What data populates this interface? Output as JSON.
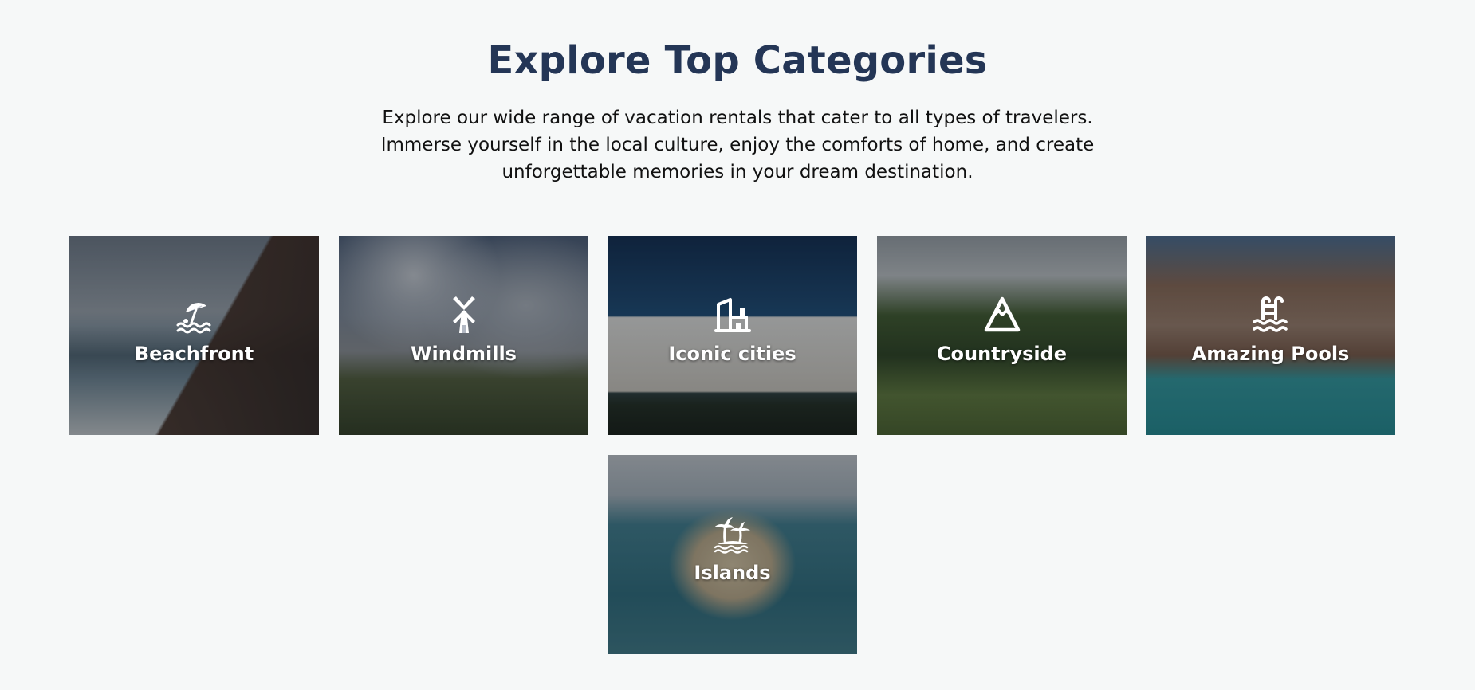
{
  "section": {
    "title": "Explore Top Categories",
    "intro_lines": [
      "Explore our wide range of vacation rentals that cater to all types of travelers.",
      "Immerse yourself in the local culture, enjoy the comforts of home, and create",
      "unforgettable memories in your dream destination."
    ]
  },
  "categories": [
    {
      "label": "Beachfront",
      "icon": "beach-umbrella-icon"
    },
    {
      "label": "Windmills",
      "icon": "windmill-icon"
    },
    {
      "label": "Iconic cities",
      "icon": "city-building-icon"
    },
    {
      "label": "Countryside",
      "icon": "mountain-icon"
    },
    {
      "label": "Amazing Pools",
      "icon": "pool-ladder-icon"
    },
    {
      "label": "Islands",
      "icon": "palm-island-icon"
    }
  ],
  "colors": {
    "background": "#f6f8f8",
    "heading": "#243656",
    "text": "#111111",
    "card_label": "#ffffff"
  }
}
